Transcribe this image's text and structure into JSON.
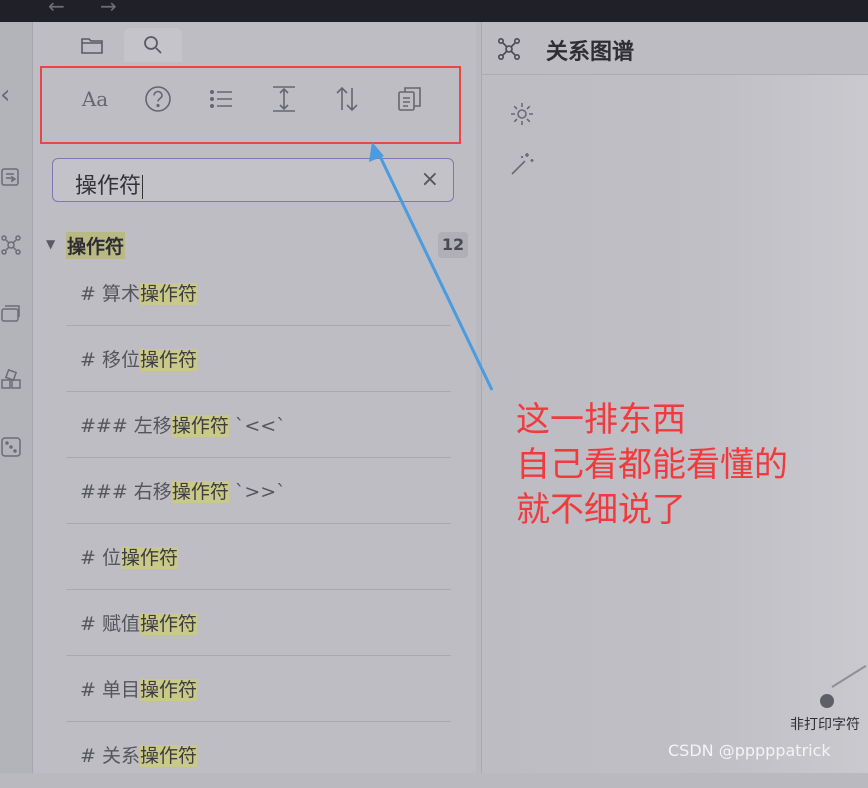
{
  "titlebar": {
    "back_glyph": "←",
    "forward_glyph": "→"
  },
  "ribbon": {
    "collapse_glyph": "‹",
    "icons": [
      "collapse-icon",
      "document-icon",
      "graph-icon",
      "cards-icon",
      "blocks-icon",
      "dice-icon"
    ]
  },
  "sidebar": {
    "tabs": [
      {
        "name": "files",
        "icon": "folder-icon",
        "active": false
      },
      {
        "name": "search",
        "icon": "search-icon",
        "active": true
      }
    ],
    "toolbar": {
      "buttons": [
        "match-case-icon",
        "help-icon",
        "list-icon",
        "expand-vertical-icon",
        "sort-icon",
        "copy-icon"
      ],
      "match_case_label": "Aa"
    },
    "search": {
      "value": "操作符",
      "clear_glyph": "×"
    },
    "result_group": {
      "title": "操作符",
      "count": "12",
      "collapse_glyph": "▼"
    },
    "results": [
      {
        "prefix": "# 算术",
        "match": "操作符",
        "suffix": ""
      },
      {
        "prefix": "# 移位",
        "match": "操作符",
        "suffix": ""
      },
      {
        "prefix": "### 左移",
        "match": "操作符",
        "suffix": " `<<`"
      },
      {
        "prefix": "### 右移",
        "match": "操作符",
        "suffix": " `>>`"
      },
      {
        "prefix": "# 位",
        "match": "操作符",
        "suffix": ""
      },
      {
        "prefix": "# 赋值",
        "match": "操作符",
        "suffix": ""
      },
      {
        "prefix": "# 单目",
        "match": "操作符",
        "suffix": ""
      },
      {
        "prefix": "# 关系",
        "match": "操作符",
        "suffix": ""
      }
    ]
  },
  "main": {
    "title": "关系图谱",
    "controls": [
      "settings-icon",
      "magic-wand-icon"
    ],
    "graph_node_label": "非打印字符"
  },
  "annotation": {
    "lines": [
      "这一排东西",
      "自己看都能看懂的",
      "就不细说了"
    ],
    "color": "#f03a3e"
  },
  "watermark": "CSDN @pppppatrick",
  "colors": {
    "highlight": "#c9c98a",
    "accent_border": "#7f79b3",
    "annotation_box": "#e8474a",
    "arrow": "#4a9be0"
  }
}
